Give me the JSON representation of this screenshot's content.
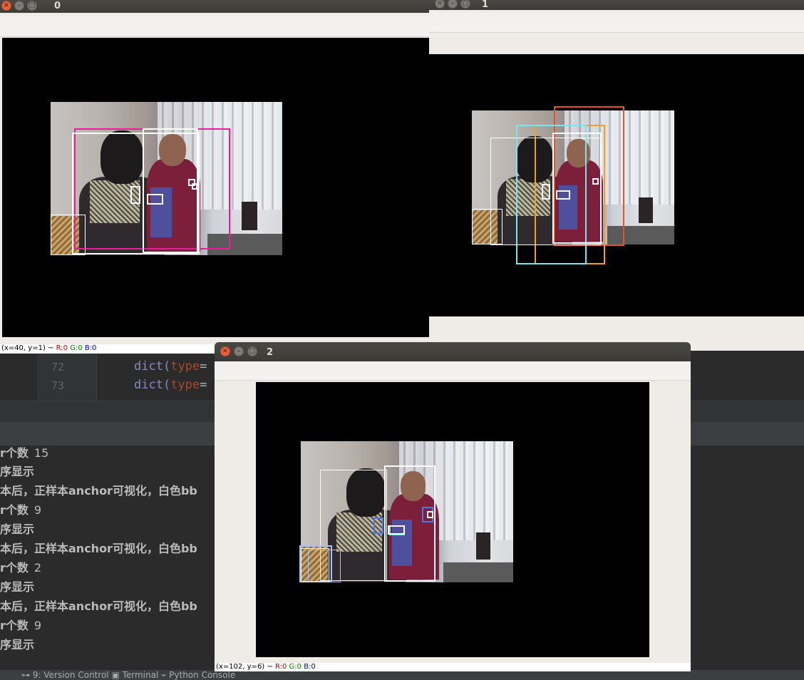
{
  "ide": {
    "line_numbers": [
      "72",
      "73"
    ],
    "code_call": "dict(",
    "code_kw": "type",
    "code_eq": "=",
    "console_lines": [
      {
        "text": "r个数",
        "num": "15"
      },
      {
        "text": "序显示",
        "num": ""
      },
      {
        "text": "本后，正样本anchor可视化，白色bb",
        "num": ""
      },
      {
        "text": "r个数",
        "num": "9"
      },
      {
        "text": "序显示",
        "num": ""
      },
      {
        "text": "本后，正样本anchor可视化，白色bb",
        "num": ""
      },
      {
        "text": "r个数",
        "num": "2"
      },
      {
        "text": "序显示",
        "num": ""
      },
      {
        "text": "本后，正样本anchor可视化，白色bb",
        "num": ""
      },
      {
        "text": "r个数",
        "num": "9"
      },
      {
        "text": "序显示",
        "num": ""
      }
    ],
    "bottom_tabs": "⊶ 9: Version Control    ▣ Terminal    ⌁ Python Console"
  },
  "windows": [
    {
      "title": "0",
      "status": {
        "coords": "(x=40, y=1) ~",
        "r": "R:0",
        "g": "G:0",
        "b": "B:0"
      }
    },
    {
      "title": "1",
      "status": null
    },
    {
      "title": "2",
      "status": {
        "coords": "(x=102, y=6) ~",
        "r": "R:0",
        "g": "G:0",
        "b": "B:0"
      }
    }
  ],
  "box_colors": {
    "white": "#ffffff",
    "magenta": "#e81e9e",
    "orange": "#f0a020",
    "red_orange": "#e2542a",
    "cyan": "#76e6ec",
    "light_blue": "#a7c0f5",
    "blue": "#4a78e6"
  }
}
